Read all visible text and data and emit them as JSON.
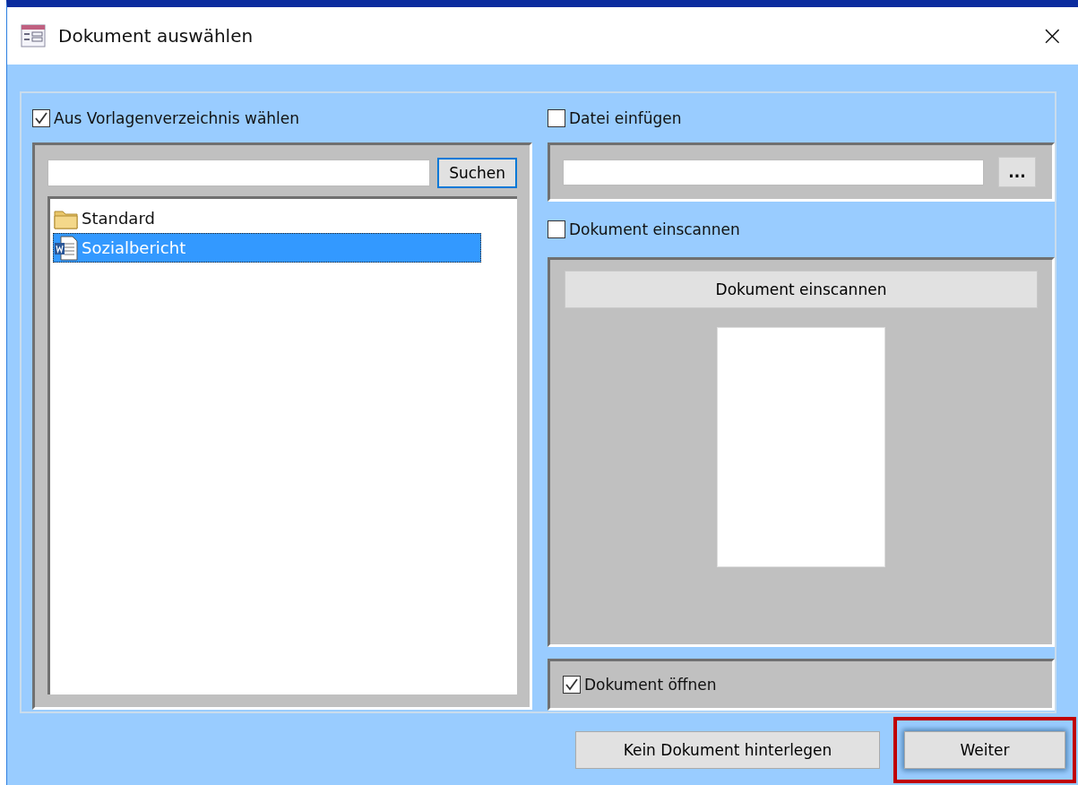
{
  "window": {
    "title": "Dokument auswählen",
    "close": "×"
  },
  "template_section": {
    "label": "Aus Vorlagenverzeichnis wählen",
    "checked": true,
    "search_button": "Suchen",
    "items": [
      {
        "kind": "folder",
        "label": "Standard",
        "selected": false
      },
      {
        "kind": "document",
        "label": "Sozialbericht",
        "selected": true
      }
    ]
  },
  "file_section": {
    "label": "Datei einfügen",
    "checked": false,
    "browse_button": "..."
  },
  "scan_section": {
    "label": "Dokument einscannen",
    "checked": false,
    "scan_button": "Dokument einscannen"
  },
  "open_option": {
    "label": "Dokument öffnen",
    "checked": true
  },
  "buttons": [
    {
      "label": "Kein Dokument hinterlegen",
      "highlighted": false
    },
    {
      "label": "Weiter",
      "highlighted": true
    }
  ]
}
